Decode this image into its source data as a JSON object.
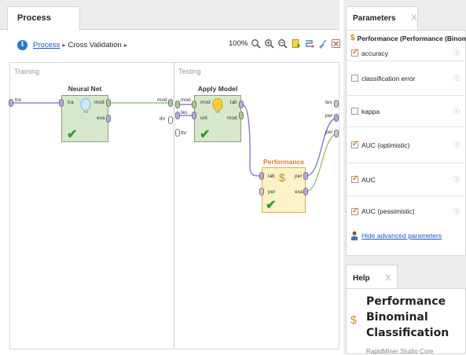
{
  "process_panel": {
    "tab_label": "Process",
    "breadcrumb": {
      "link": "Process",
      "separator": "▸",
      "current": "Cross Validation"
    },
    "zoom": "100%",
    "areas": {
      "training": "Training",
      "testing": "Testing"
    },
    "operators": {
      "neural_net": {
        "title": "Neural Net",
        "ports_in": [
          "tra"
        ],
        "ports_out": [
          "mod",
          "exa"
        ]
      },
      "apply_model": {
        "title": "Apply Model",
        "ports_in": [
          "mod",
          "unl"
        ],
        "ports_out": [
          "lab",
          "mod"
        ]
      },
      "performance": {
        "title": "Performance",
        "ports_in": [
          "lab",
          "per"
        ],
        "ports_out": [
          "per",
          "exa"
        ]
      }
    },
    "boundary_ports": {
      "training_left": "tra",
      "training_right": [
        "mod",
        "thr"
      ],
      "testing_left": [
        "mod",
        "tes",
        "thr"
      ],
      "testing_right": [
        "tes",
        "per",
        "per"
      ]
    }
  },
  "parameters_panel": {
    "tab_label": "Parameters",
    "close_glyph": "X",
    "title": "Performance (Performance (Binominal",
    "rows": [
      {
        "label": "accuracy",
        "checked": true
      },
      {
        "label": "classification error",
        "checked": false
      },
      {
        "label": "kappa",
        "checked": false
      },
      {
        "label": "AUC (optimistic)",
        "checked": true
      },
      {
        "label": "AUC",
        "checked": true
      },
      {
        "label": "AUC (pessimistic)",
        "checked": true
      }
    ],
    "info_glyph": "ⓘ",
    "hide_advanced": "Hide advanced parameters"
  },
  "help_panel": {
    "tab_label": "Help",
    "close_glyph": "X",
    "title_lines": [
      "Performance",
      "Binominal",
      "Classification"
    ],
    "subtitle": "RapidMiner Studio Core"
  },
  "colors": {
    "operator_green": "#d7e7cc",
    "operator_performance": "#fdf1c8",
    "operator_performance_title": "#e8751a",
    "link_blue": "#1a57c8",
    "checkmark": "#2e9a2e",
    "connector_purple": "#8f7fd6",
    "connector_green": "#9cc383"
  }
}
